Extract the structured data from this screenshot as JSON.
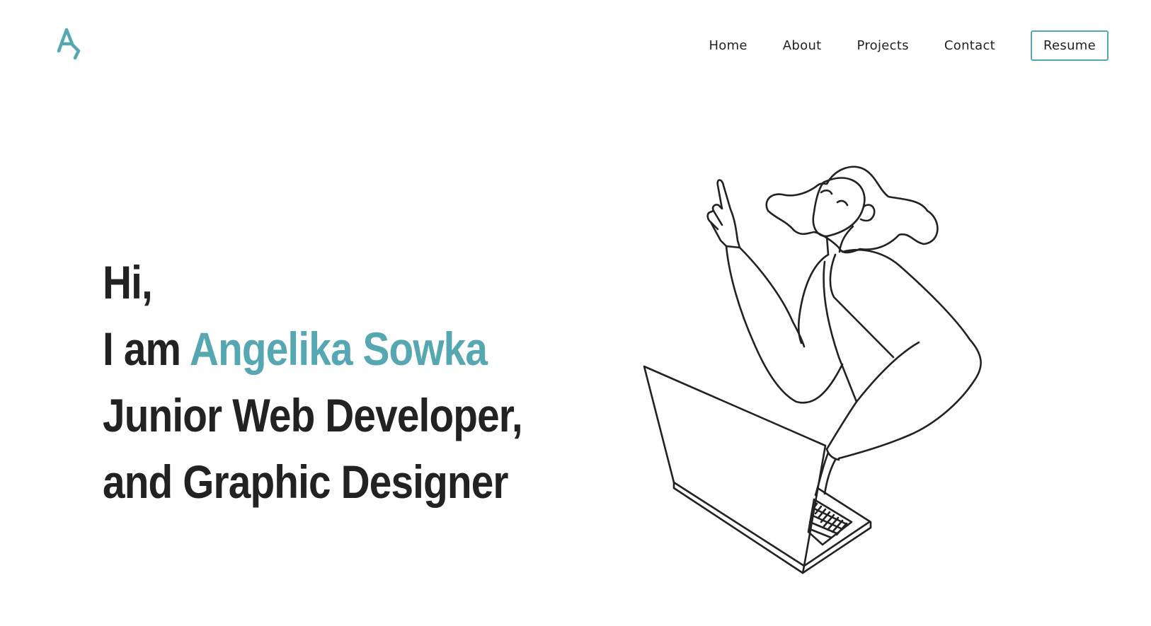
{
  "colors": {
    "accent": "#55a7b1",
    "text": "#222222",
    "background": "#ffffff"
  },
  "header": {
    "logo_icon": "monogram-logo-icon",
    "nav": {
      "home": "Home",
      "about": "About",
      "projects": "Projects",
      "contact": "Contact"
    },
    "resume_label": "Resume"
  },
  "hero": {
    "greeting": "Hi,",
    "intro": "I am",
    "name": "Angelika Sowka",
    "role_line_1": "Junior Web Developer,",
    "role_line_2": "and Graphic Designer"
  },
  "illustration": {
    "icon": "woman-with-laptop-illustration"
  }
}
